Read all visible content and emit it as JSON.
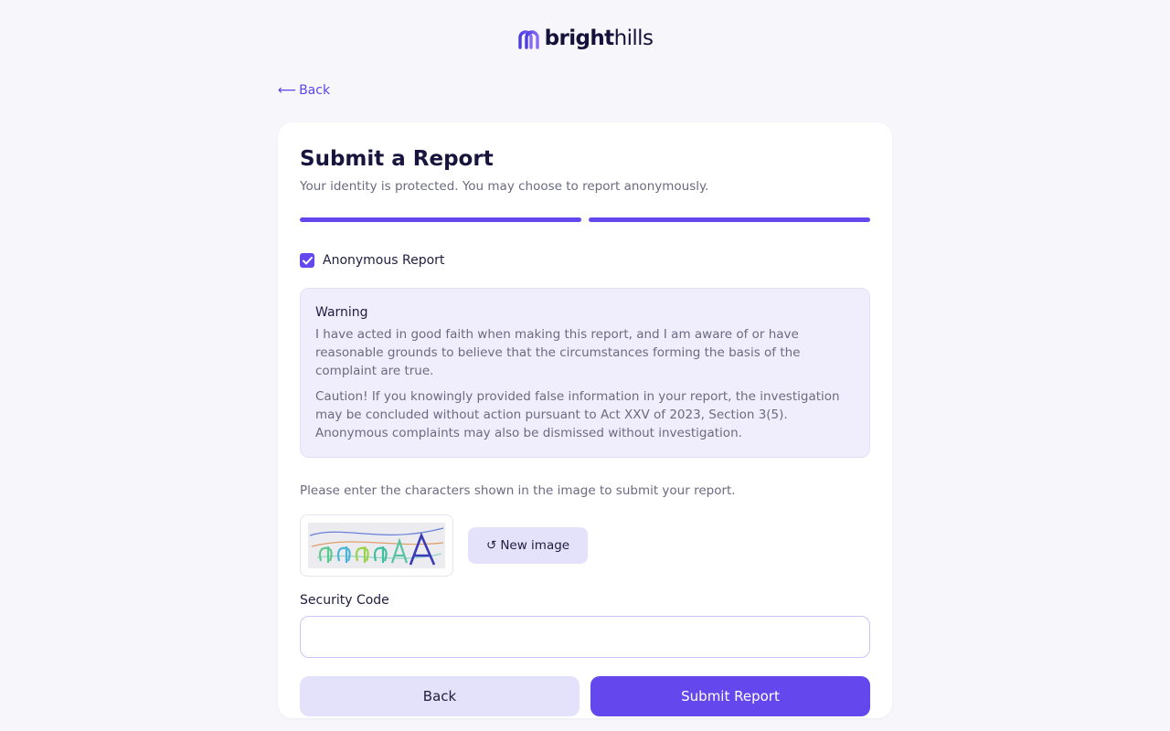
{
  "brand": {
    "name_bold": "bright",
    "name_light": "hills",
    "accent_color": "#6448ee",
    "logo_icon": "bridge-arc-icon"
  },
  "nav": {
    "back_arrow": "⟵",
    "back_label": "Back"
  },
  "form": {
    "title": "Submit a Report",
    "subtitle": "Your identity is protected. You may choose to report anonymously.",
    "progress": {
      "total_steps": 2,
      "completed_steps": 2
    },
    "anonymous": {
      "label": "Anonymous Report",
      "checked": true
    },
    "warning": {
      "title": "Warning",
      "paragraph1": "I have acted in good faith when making this report, and I am aware of or have reasonable grounds to believe that the circumstances forming the basis of the complaint are true.",
      "paragraph2": "Caution! If you knowingly provided false information in your report, the investigation may be concluded without action pursuant to Act XXV of 2023, Section 3(5). Anonymous complaints may also be dismissed without investigation."
    },
    "captcha": {
      "instruction": "Please enter the characters shown in the image to submit your report.",
      "new_image_icon": "↺",
      "new_image_label": "New image"
    },
    "security_code": {
      "label": "Security Code",
      "value": "",
      "placeholder": ""
    },
    "actions": {
      "back_label": "Back",
      "submit_label": "Submit Report"
    }
  }
}
